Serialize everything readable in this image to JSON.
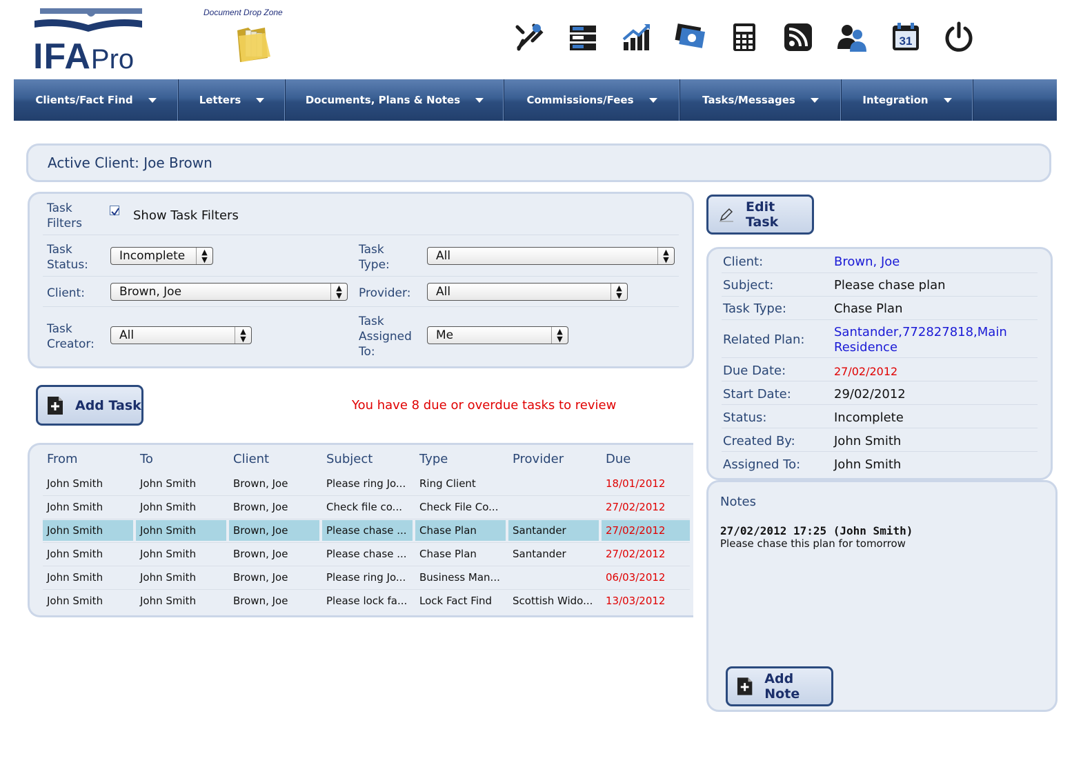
{
  "logo": {
    "ifa": "IFA",
    "pro": "Pro"
  },
  "dropzone": {
    "label": "Document Drop Zone"
  },
  "top_icons": [
    {
      "name": "tools-icon"
    },
    {
      "name": "folders-icon"
    },
    {
      "name": "chart-icon"
    },
    {
      "name": "money-icon"
    },
    {
      "name": "calculator-icon"
    },
    {
      "name": "rss-icon"
    },
    {
      "name": "users-icon"
    },
    {
      "name": "calendar-icon",
      "text": "31"
    },
    {
      "name": "power-icon"
    }
  ],
  "nav": [
    {
      "label": "Clients/Fact Find"
    },
    {
      "label": "Letters"
    },
    {
      "label": "Documents, Plans & Notes"
    },
    {
      "label": "Commissions/Fees"
    },
    {
      "label": "Tasks/Messages"
    },
    {
      "label": "Integration"
    }
  ],
  "active_client": "Active Client: Joe Brown",
  "filters": {
    "task_filters_label": "Task Filters",
    "show_filters_label": "Show Task Filters",
    "task_status_label": "Task Status:",
    "task_status_value": "Incomplete",
    "task_type_label": "Task Type:",
    "task_type_value": "All",
    "client_label": "Client:",
    "client_value": "Brown, Joe",
    "provider_label": "Provider:",
    "provider_value": "All",
    "task_creator_label": "Task Creator:",
    "task_creator_value": "All",
    "assigned_label": "Task Assigned To:",
    "assigned_value": "Me"
  },
  "edit_task_label": "Edit Task",
  "add_task_label": "Add Task",
  "overdue_message": "You have 8 due or overdue tasks to review",
  "table": {
    "headers": [
      "From",
      "To",
      "Client",
      "Subject",
      "Type",
      "Provider",
      "Due"
    ],
    "rows": [
      [
        "John Smith",
        "John Smith",
        "Brown, Joe",
        "Please ring Jo...",
        "Ring Client",
        "",
        "18/01/2012"
      ],
      [
        "John Smith",
        "John Smith",
        "Brown, Joe",
        "Check file co...",
        "Check File Co...",
        "",
        "27/02/2012"
      ],
      [
        "John Smith",
        "John Smith",
        "Brown, Joe",
        "Please chase ...",
        "Chase Plan",
        "Santander",
        "27/02/2012"
      ],
      [
        "John Smith",
        "John Smith",
        "Brown, Joe",
        "Please chase ...",
        "Chase Plan",
        "Santander",
        "27/02/2012"
      ],
      [
        "John Smith",
        "John Smith",
        "Brown, Joe",
        "Please ring Jo...",
        "Business Man...",
        "",
        "06/03/2012"
      ],
      [
        "John Smith",
        "John Smith",
        "Brown, Joe",
        "Please lock fa...",
        "Lock Fact Find",
        "Scottish Wido...",
        "13/03/2012"
      ]
    ],
    "selected_row": 2
  },
  "details": {
    "client_label": "Client:",
    "client": "Brown, Joe",
    "subject_label": "Subject:",
    "subject": "Please chase plan",
    "task_type_label": "Task Type:",
    "task_type": "Chase Plan",
    "related_plan_label": "Related Plan:",
    "related_plan_line1": "Santander,772827818,Main",
    "related_plan_line2": "Residence",
    "due_date_label": "Due Date:",
    "due_date": "27/02/2012",
    "start_date_label": "Start Date:",
    "start_date": "29/02/2012",
    "status_label": "Status:",
    "status": "Incomplete",
    "created_by_label": "Created By:",
    "created_by": "John Smith",
    "assigned_to_label": "Assigned To:",
    "assigned_to": "John Smith"
  },
  "notes": {
    "title": "Notes",
    "entry_header": "27/02/2012 17:25 (John Smith)",
    "entry_body": "Please chase this plan for tomorrow",
    "add_note_label": "Add Note"
  },
  "colors": {
    "nav_dark": "#223f6c",
    "nav_light": "#5d80b2",
    "link": "#1a1ad6",
    "overdue": "#e00000",
    "selected_row": "#a9d5e3"
  }
}
